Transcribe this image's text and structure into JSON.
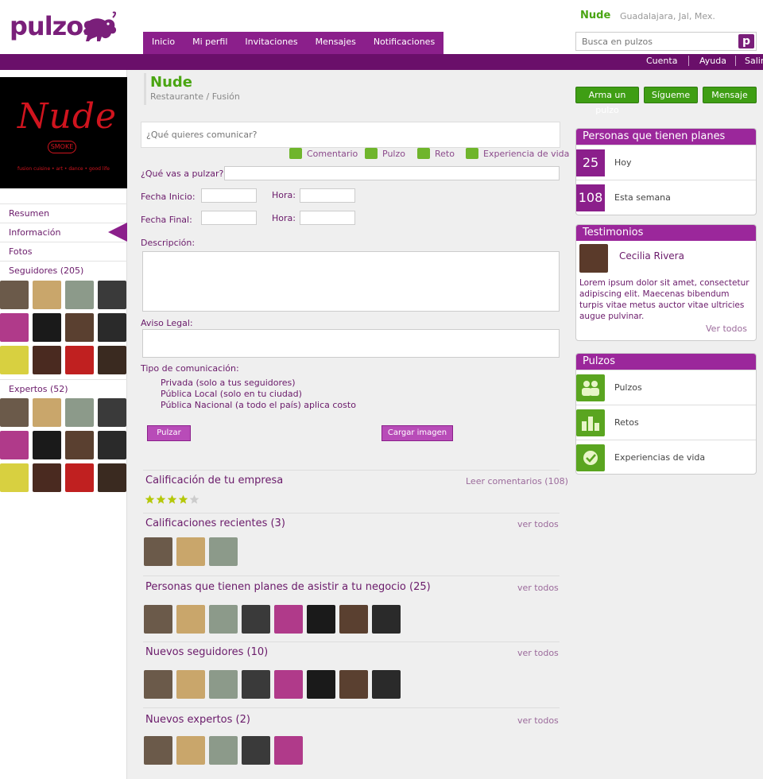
{
  "app": {
    "logo_text": "pulzos",
    "brand_color": "#7a1f7a",
    "accent_green": "#4aa512"
  },
  "header": {
    "nav_tabs": [
      "Inicio",
      "Mi perfil",
      "Invitaciones",
      "Mensajes",
      "Notificaciones"
    ],
    "profile_name": "Nude",
    "location": "Guadalajara, Jal, Mex.",
    "search_placeholder": "Busca en pulzos",
    "search_icon_label": "p",
    "top_links": [
      "Cuenta",
      "Ayuda",
      "Salir"
    ]
  },
  "sidebar": {
    "logo_text": "Nude",
    "logo_badge": "SMOKE",
    "logo_tagline": "fusion cuisine • art • dance • good life",
    "nav": [
      "Resumen",
      "Información",
      "Fotos"
    ],
    "followers_label": "Seguidores (205)",
    "experts_label": "Expertos (52)"
  },
  "business": {
    "name": "Nude",
    "category": "Restaurante / Fusión",
    "actions": [
      "Arma un pulzo",
      "Sígueme",
      "Mensaje"
    ]
  },
  "compose": {
    "placeholder": "¿Qué quieres comunicar?",
    "types": [
      "Comentario",
      "Pulzo",
      "Reto",
      "Experiencia de vida"
    ],
    "pulzar_label": "¿Qué vas a pulzar?",
    "start_date_label": "Fecha Inicio:",
    "end_date_label": "Fecha Final:",
    "time_label": "Hora:",
    "description_label": "Descripción:",
    "legal_label": "Aviso Legal:",
    "comm_type_label": "Tipo de comunicación:",
    "comm_options": [
      "Privada (solo a tus seguidores)",
      "Pública Local (solo en tu ciudad)",
      "Pública Nacional (a todo el país) aplica costo"
    ],
    "submit_label": "Pulzar",
    "upload_label": "Cargar imagen"
  },
  "sections": {
    "rating": {
      "title": "Calificación  de tu empresa",
      "link": "Leer comentarios (108)",
      "stars": 4,
      "max": 5
    },
    "recent": {
      "title": "Calificaciones recientes (3)",
      "link": "ver todos"
    },
    "plans": {
      "title": "Personas que tienen planes de asistir a tu negocio (25)",
      "link": "ver todos"
    },
    "new_followers": {
      "title": "Nuevos seguidores (10)",
      "link": "ver todos"
    },
    "new_experts": {
      "title": "Nuevos expertos (2)",
      "link": "ver todos"
    }
  },
  "right": {
    "plans_title": "Personas que tienen planes",
    "plans_rows": [
      {
        "count": "25",
        "label": "Hoy"
      },
      {
        "count": "108",
        "label": "Esta semana"
      }
    ],
    "testimonials_title": "Testimonios",
    "testimonial_name": "Cecilia Rivera",
    "testimonial_text": "Lorem ipsum dolor sit amet, consectetur adipiscing elit. Maecenas bibendum turpis vitae metus auctor vitae ultricies augue pulvinar.",
    "testimonial_link": "Ver todos",
    "pulzos_title": "Pulzos",
    "pulzos_items": [
      "Pulzos",
      "Retos",
      "Experiencias de vida"
    ]
  }
}
